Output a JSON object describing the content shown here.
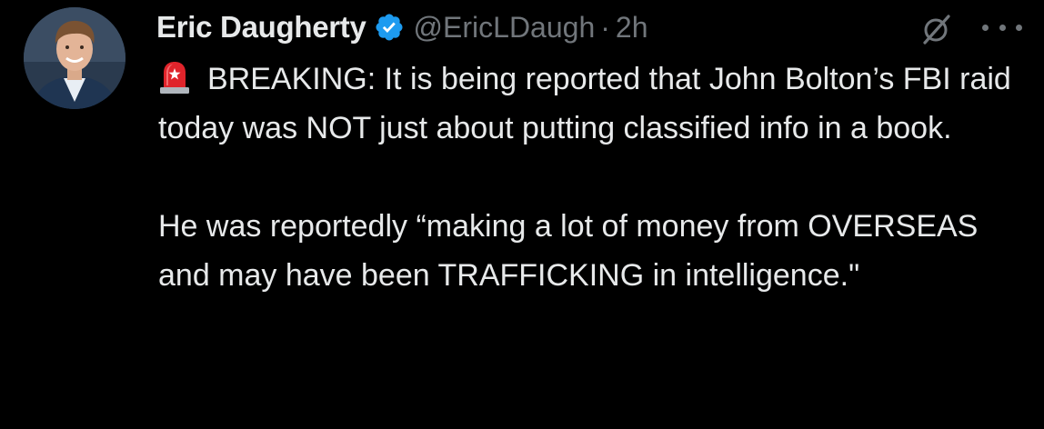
{
  "tweet": {
    "author_name": "Eric Daugherty",
    "handle": "@EricLDaugh",
    "separator": "·",
    "time": "2h",
    "icons": {
      "avatar": "profile-photo",
      "verified": "verified-badge-icon",
      "grok": "grok-icon",
      "more": "more-options-icon",
      "siren": "police-siren-emoji"
    },
    "paragraph1": "BREAKING: It is being reported that John Bolton’s FBI raid today was NOT just about putting classified info in a book.",
    "paragraph2": "He was reportedly “making a lot of money from OVERSEAS and may have been TRAFFICKING in intelligence.\""
  },
  "colors": {
    "background": "#000000",
    "text_primary": "#e7e9ea",
    "text_secondary": "#71767b",
    "verified_blue": "#1d9bf0",
    "siren_red": "#e0242b"
  }
}
